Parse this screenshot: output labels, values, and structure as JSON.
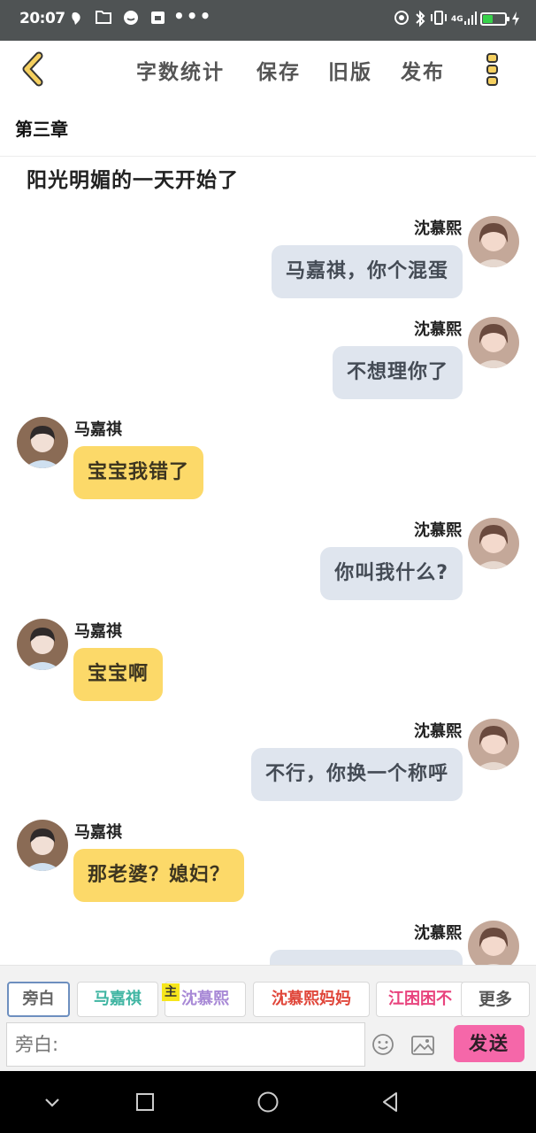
{
  "status_bar": {
    "time": "20:07",
    "more_dots": "•••",
    "signal": "4G",
    "battery_level": 0.45
  },
  "nav": {
    "items": [
      {
        "label": "字数统计"
      },
      {
        "label": "保存"
      },
      {
        "label": "旧版"
      },
      {
        "label": "发布"
      }
    ]
  },
  "chapter": {
    "title": "第三章"
  },
  "narration": "阳光明媚的一天开始了",
  "messages": [
    {
      "side": "right",
      "sender": "沈慕熙",
      "text": "马嘉祺，你个混蛋"
    },
    {
      "side": "right",
      "sender": "沈慕熙",
      "text": "不想理你了"
    },
    {
      "side": "left",
      "sender": "马嘉祺",
      "text": "宝宝我错了"
    },
    {
      "side": "right",
      "sender": "沈慕熙",
      "text": "你叫我什么?"
    },
    {
      "side": "left",
      "sender": "马嘉祺",
      "text": "宝宝啊"
    },
    {
      "side": "right",
      "sender": "沈慕熙",
      "text": "不行，你换一个称呼"
    },
    {
      "side": "left",
      "sender": "马嘉祺",
      "text": "那老婆？媳妇？"
    },
    {
      "side": "right",
      "sender": "沈慕熙",
      "text": ""
    }
  ],
  "toolbar": {
    "roles": [
      {
        "label": "旁白",
        "color": "#666666"
      },
      {
        "label": "马嘉祺",
        "color": "#3fb5a2"
      },
      {
        "label": "沈慕熙",
        "color": "#a889d6"
      },
      {
        "label": "沈慕熙妈妈",
        "color": "#e0473b"
      },
      {
        "label": "江困困不",
        "color": "#e8437d"
      }
    ],
    "main_badge": "主",
    "more_label": "更多",
    "input_placeholder": "旁白:",
    "send_label": "发送"
  },
  "colors": {
    "accent_yellow": "#f5d060",
    "send_pink": "#f567a9",
    "bubble_self": "#dfe5ee",
    "bubble_other": "#fcd969"
  }
}
